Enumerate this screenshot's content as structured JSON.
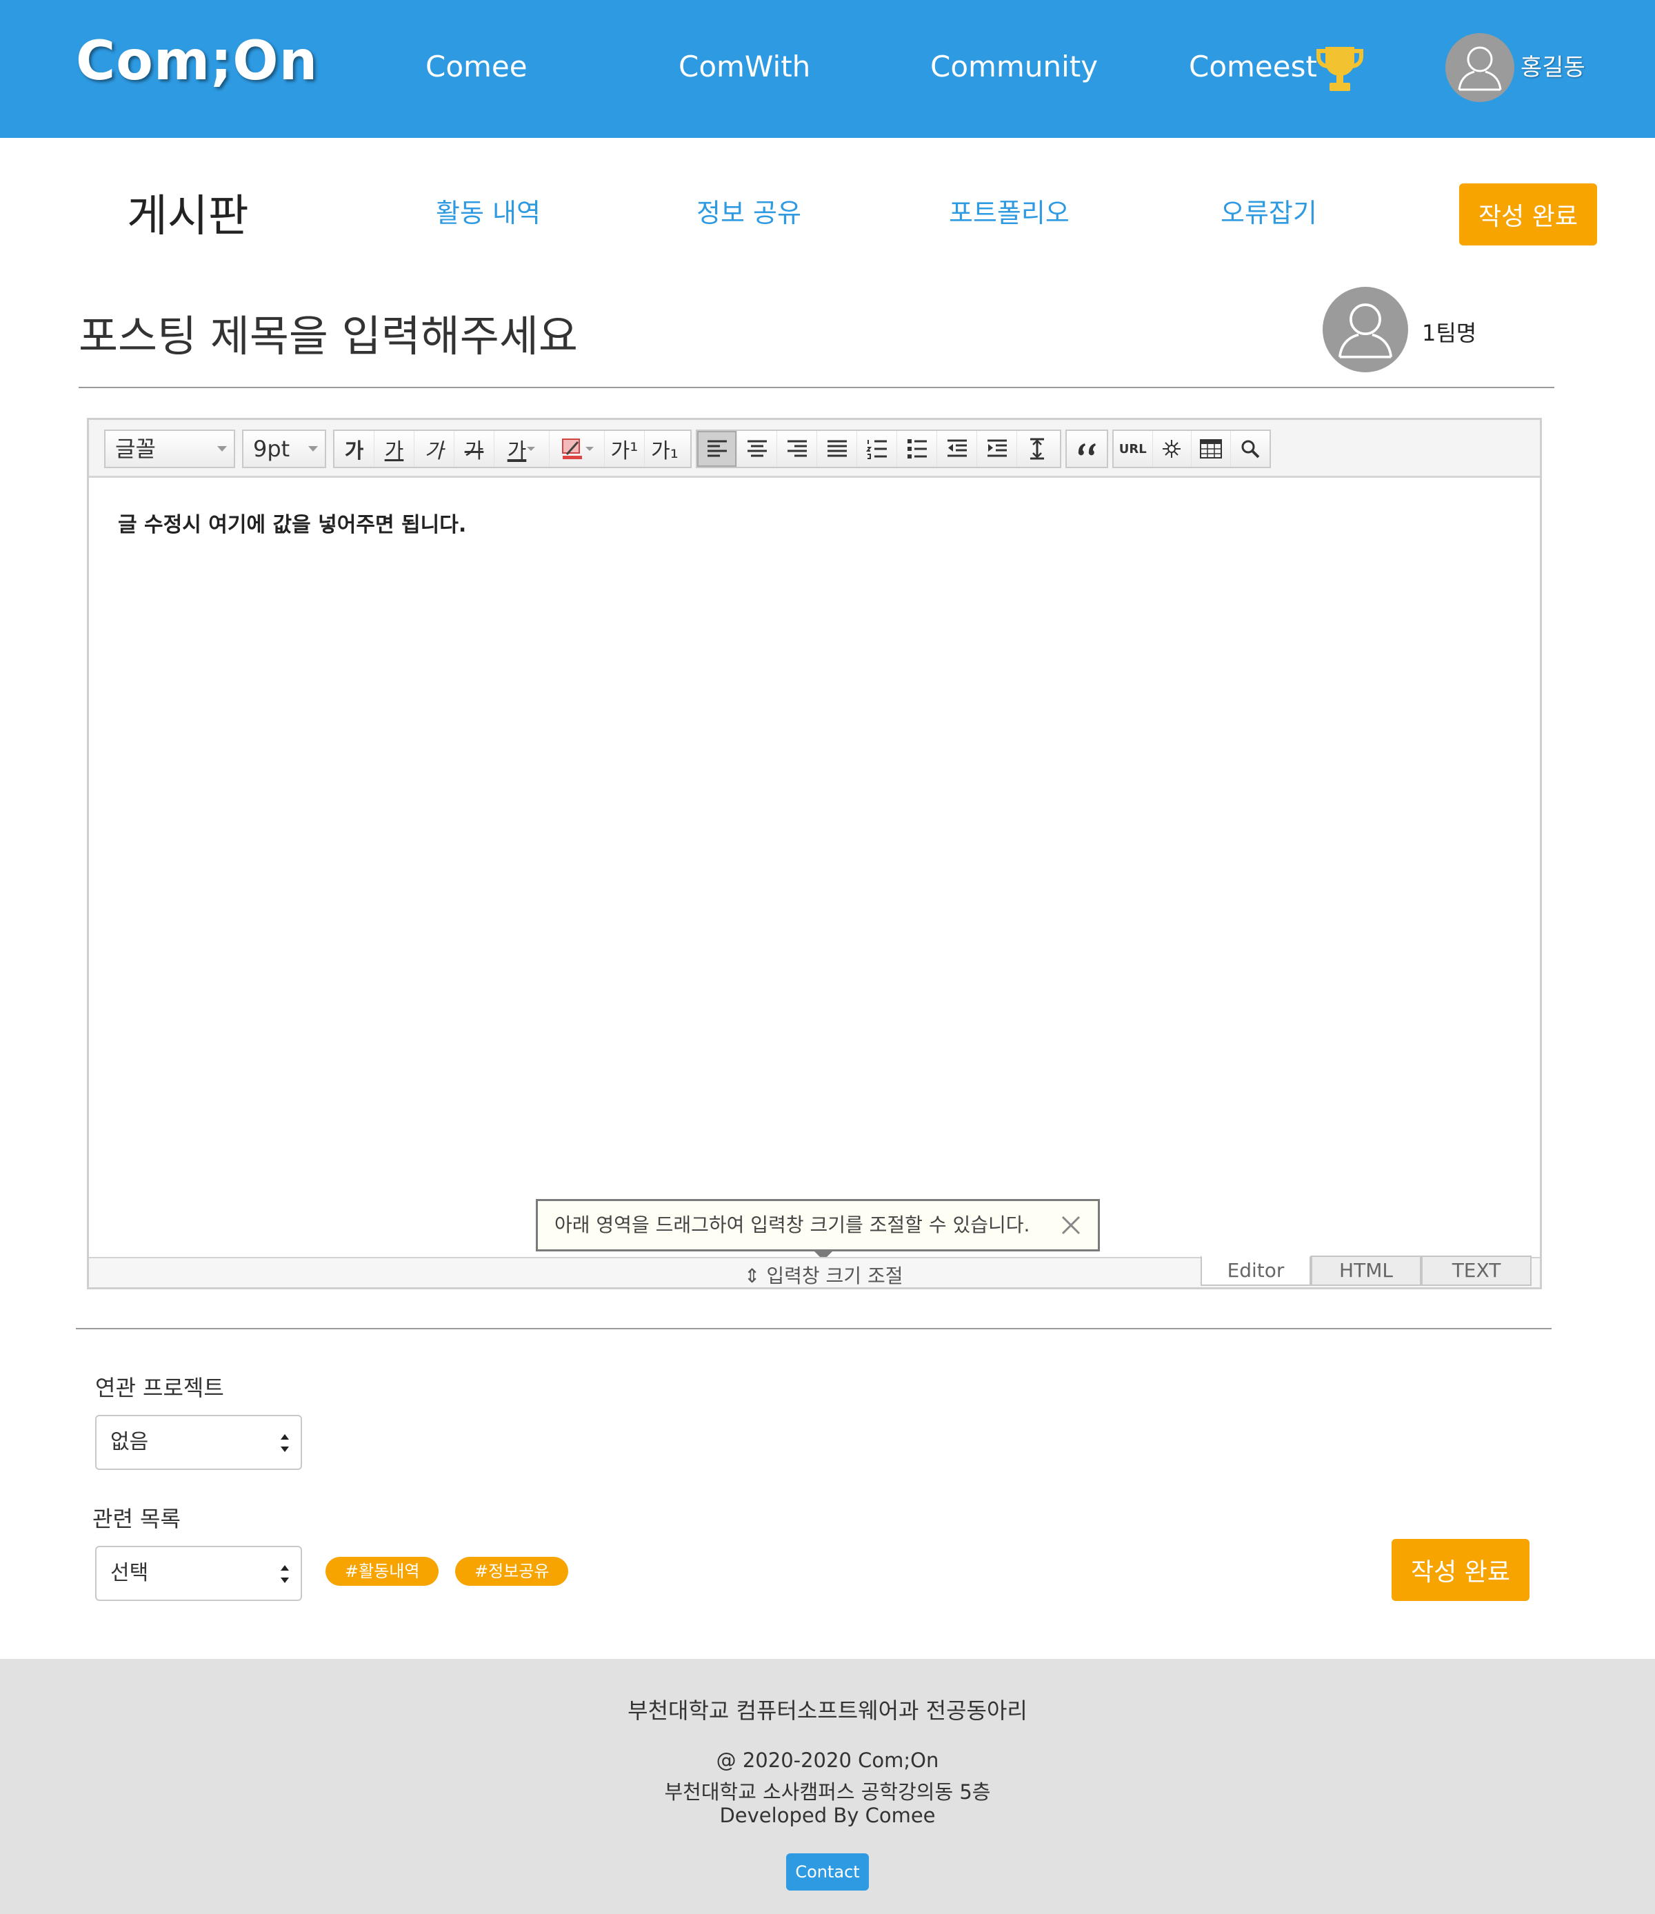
{
  "header": {
    "logo": "Com;On",
    "nav": [
      "Comee",
      "ComWith",
      "Community",
      "Comeest"
    ],
    "user_name": "홍길동"
  },
  "board": {
    "title": "게시판",
    "menu": [
      "활동 내역",
      "정보 공유",
      "포트폴리오",
      "오류잡기"
    ],
    "submit_label": "작성 완료"
  },
  "post": {
    "title_placeholder": "포스팅 제목을 입력해주세요",
    "team_name": "1팀명"
  },
  "editor": {
    "font_select": "글꼴",
    "size_select": "9pt",
    "body_text": "글 수정시 여기에 값을 넣어주면 됩니다.",
    "resize_tip": "아래 영역을 드래그하여 입력창 크기를 조절할 수 있습니다.",
    "resize_handle": "⇕ 입력창 크기 조절",
    "modes": [
      "Editor",
      "HTML",
      "TEXT"
    ],
    "toolbar": {
      "format": [
        "가",
        "가",
        "가",
        "가",
        "가"
      ],
      "script": [
        "가¹",
        "가₁"
      ],
      "url": "URL"
    }
  },
  "form": {
    "project_label": "연관 프로젝트",
    "project_value": "없음",
    "category_label": "관련 목록",
    "category_value": "선택",
    "tags": [
      "#활동내역",
      "#정보공유"
    ],
    "submit_label": "작성 완료"
  },
  "footer": {
    "org": "부천대학교 컴퓨터소프트웨어과 전공동아리",
    "copyright": "@ 2020-2020 Com;On",
    "address": "부천대학교 소사캠퍼스 공학강의동 5층",
    "developer": "Developed By Comee",
    "contact_label": "Contact"
  },
  "colors": {
    "primary": "#2e9ae2",
    "accent": "#f7a300",
    "footer_bg": "#e1e1e1",
    "trophy": "#f2c230"
  }
}
